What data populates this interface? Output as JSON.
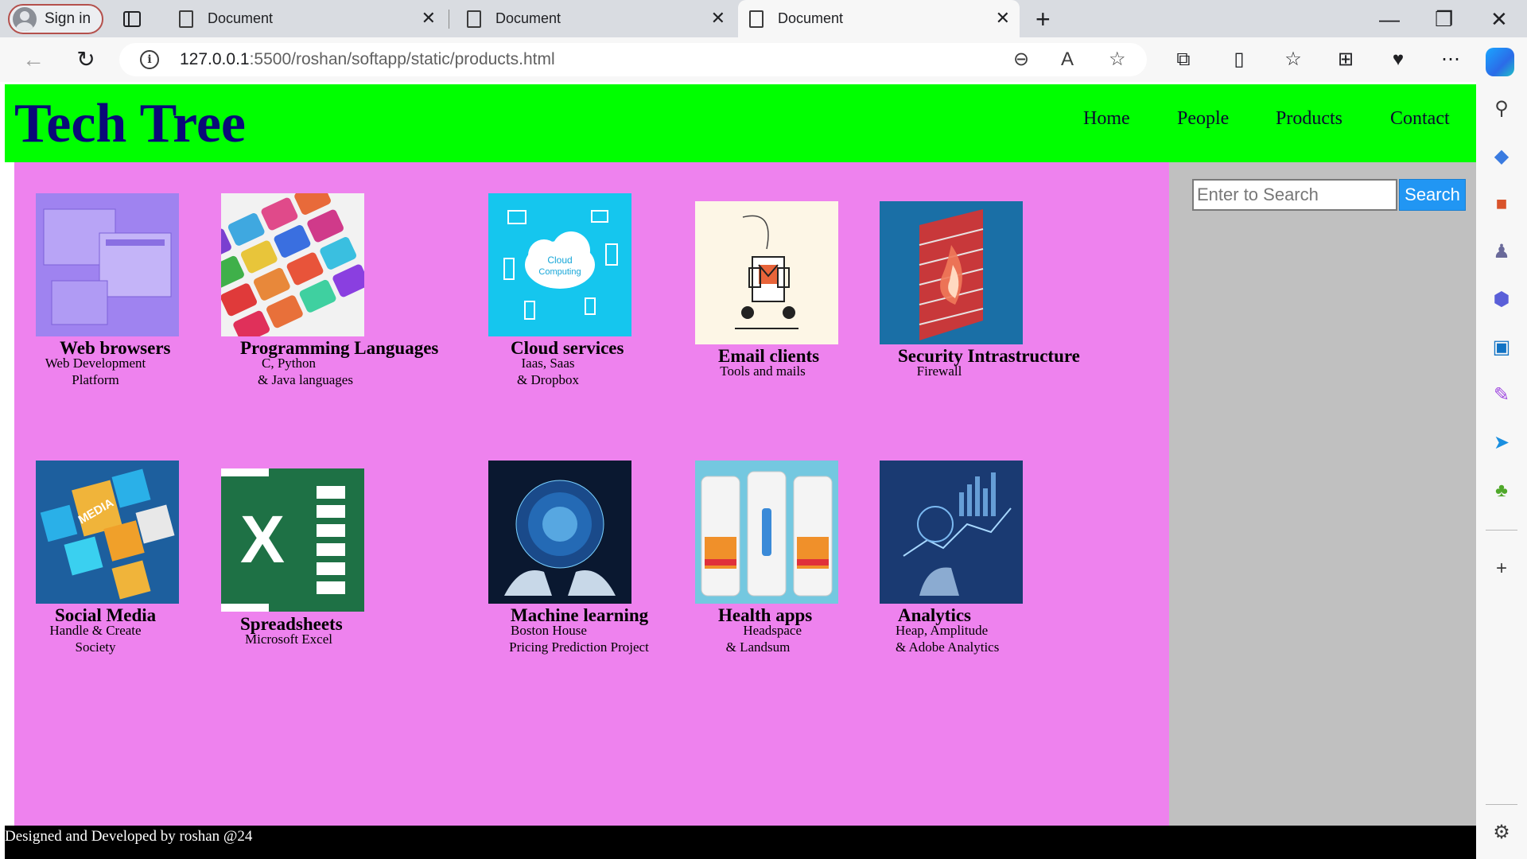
{
  "browser": {
    "signin_label": "Sign in",
    "tabs": [
      {
        "title": "Document"
      },
      {
        "title": "Document"
      },
      {
        "title": "Document"
      }
    ],
    "url_host": "127.0.0.1",
    "url_rest": ":5500/roshan/softapp/static/products.html"
  },
  "site": {
    "brand": "Tech Tree",
    "nav": [
      "Home",
      "People",
      "Products",
      "Contact"
    ],
    "search": {
      "placeholder": "Enter to Search",
      "button": "Search"
    },
    "footer": "Designed and Developed by roshan @24"
  },
  "products": [
    {
      "title": "Web browsers",
      "desc1": "Web Development",
      "desc2": "Platform",
      "icon": "browser-windows-image"
    },
    {
      "title": "Programming Languages",
      "desc1": "C, Python",
      "desc2": "& Java languages",
      "icon": "keyboard-keys-image"
    },
    {
      "title": "Cloud services",
      "desc1": "Iaas, Saas",
      "desc2": "& Dropbox",
      "icon": "cloud-computing-image"
    },
    {
      "title": "Email clients",
      "desc1": "Tools and mails",
      "desc2": "",
      "icon": "email-illustration-image"
    },
    {
      "title": "Security Intrastructure",
      "desc1": "Firewall",
      "desc2": "",
      "icon": "firewall-image"
    },
    {
      "title": "Social Media",
      "desc1": "Handle & Create",
      "desc2": "Society",
      "icon": "social-media-cubes-image"
    },
    {
      "title": "Spreadsheets",
      "desc1": "Microsoft Excel",
      "desc2": "",
      "icon": "excel-logo-image"
    },
    {
      "title": "Machine learning",
      "desc1": "Boston House",
      "desc2": "Pricing Prediction Project",
      "icon": "ai-robot-hands-image"
    },
    {
      "title": "Health apps",
      "desc1": "Headspace",
      "desc2": "& Landsum",
      "icon": "phone-apps-image"
    },
    {
      "title": "Analytics",
      "desc1": "Heap, Amplitude",
      "desc2": "& Adobe Analytics",
      "icon": "analytics-charts-image"
    }
  ],
  "colors": {
    "header_bg": "#00ff00",
    "brand_color": "#0a0a78",
    "main_bg": "#ee82ee",
    "aside_bg": "#c0c0c0",
    "footer_bg": "#000000",
    "search_button": "#2196f3"
  }
}
